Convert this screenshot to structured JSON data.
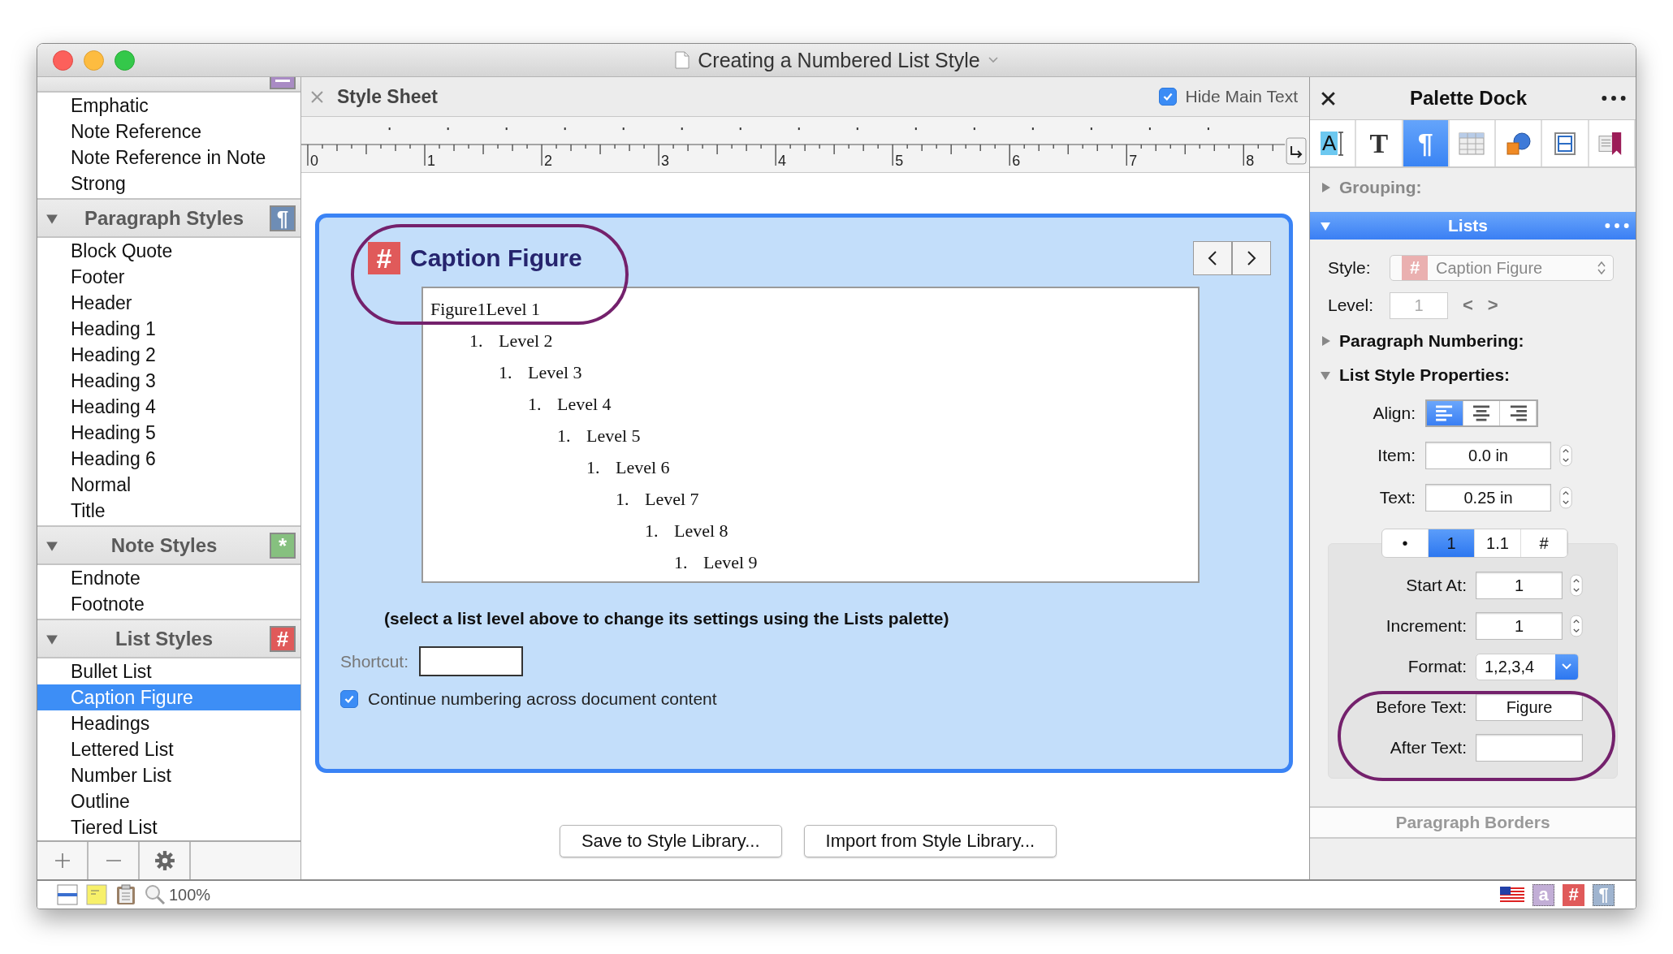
{
  "window": {
    "title": "Creating a Numbered List Style"
  },
  "sidebar": {
    "sections": [
      {
        "color": "#a98bc4",
        "items": [
          {
            "label": "Emphatic",
            "selected": false
          },
          {
            "label": "Note Reference",
            "selected": false
          },
          {
            "label": "Note Reference in Note",
            "selected": false
          },
          {
            "label": "Strong",
            "selected": false
          }
        ]
      },
      {
        "title": "Paragraph Styles",
        "expanded": true,
        "glyph": "¶",
        "color": "#6e8db5",
        "items": [
          {
            "label": "Block Quote",
            "selected": false
          },
          {
            "label": "Footer",
            "selected": false
          },
          {
            "label": "Header",
            "selected": false
          },
          {
            "label": "Heading 1",
            "selected": false
          },
          {
            "label": "Heading 2",
            "selected": false
          },
          {
            "label": "Heading 3",
            "selected": false
          },
          {
            "label": "Heading 4",
            "selected": false
          },
          {
            "label": "Heading 5",
            "selected": false
          },
          {
            "label": "Heading 6",
            "selected": false
          },
          {
            "label": "Normal",
            "selected": false
          },
          {
            "label": "Title",
            "selected": false
          }
        ]
      },
      {
        "title": "Note Styles",
        "expanded": true,
        "glyph": "*",
        "color": "#86c07f",
        "items": [
          {
            "label": "Endnote",
            "selected": false
          },
          {
            "label": "Footnote",
            "selected": false
          }
        ]
      },
      {
        "title": "List Styles",
        "expanded": true,
        "glyph": "#",
        "color": "#e05a5a",
        "items": [
          {
            "label": "Bullet List",
            "selected": false
          },
          {
            "label": "Caption Figure",
            "selected": true
          },
          {
            "label": "Headings",
            "selected": false
          },
          {
            "label": "Lettered List",
            "selected": false
          },
          {
            "label": "Number List",
            "selected": false
          },
          {
            "label": "Outline",
            "selected": false
          },
          {
            "label": "Tiered List",
            "selected": false
          }
        ]
      }
    ]
  },
  "style_sheet": {
    "title": "Style Sheet",
    "hide_main_text": {
      "label": "Hide Main Text",
      "checked": true
    },
    "ruler_labels": [
      "0",
      "1",
      "2",
      "3",
      "4",
      "5",
      "6",
      "7",
      "8"
    ],
    "style": {
      "glyph": "#",
      "name": "Caption Figure"
    },
    "preview": [
      {
        "text": "Figure1Level 1",
        "children": [
          {
            "number": "1.",
            "text": "Level 2",
            "children": [
              {
                "number": "1.",
                "text": "Level 3",
                "children": [
                  {
                    "number": "1.",
                    "text": "Level 4",
                    "children": [
                      {
                        "number": "1.",
                        "text": "Level 5",
                        "children": [
                          {
                            "number": "1.",
                            "text": "Level 6",
                            "children": [
                              {
                                "number": "1.",
                                "text": "Level 7",
                                "children": [
                                  {
                                    "number": "1.",
                                    "text": "Level 8",
                                    "children": [
                                      {
                                        "number": "1.",
                                        "text": "Level 9"
                                      }
                                    ]
                                  }
                                ]
                              }
                            ]
                          }
                        ]
                      }
                    ]
                  }
                ]
              }
            ]
          }
        ]
      }
    ],
    "hint": "(select a list level above to change its settings using the Lists palette)",
    "shortcut": {
      "label": "Shortcut:"
    },
    "continue_numbering": {
      "label": "Continue numbering across document content",
      "checked": true
    },
    "buttons": [
      "Save to Style Library...",
      "Import from Style Library..."
    ]
  },
  "palette": {
    "title": "Palette Dock",
    "tools": [
      {
        "kind": "character",
        "glyph": "A",
        "selected": false
      },
      {
        "kind": "text",
        "glyph": "T",
        "selected": false
      },
      {
        "kind": "paragraph",
        "glyph": "¶",
        "selected": true
      },
      {
        "kind": "table",
        "selected": false
      },
      {
        "kind": "shapes",
        "selected": false
      },
      {
        "kind": "layout",
        "selected": false
      },
      {
        "kind": "bookmark",
        "selected": false
      }
    ],
    "grouping": {
      "label": "Grouping:",
      "expanded": false
    },
    "lists": {
      "title": "Lists",
      "expanded": true,
      "style": {
        "label": "Style:",
        "glyph": "#",
        "value": "Caption Figure",
        "disabled": true
      },
      "level": {
        "label": "Level:",
        "value": "1",
        "disabled": true,
        "prev": "<",
        "next": ">"
      },
      "paragraph_numbering": {
        "label": "Paragraph Numbering:",
        "expanded": false
      },
      "list_style_properties": {
        "label": "List Style Properties:",
        "expanded": true
      },
      "align": {
        "label": "Align:",
        "options": [
          {
            "kind": "left",
            "selected": true
          },
          {
            "kind": "center",
            "selected": false
          },
          {
            "kind": "right",
            "selected": false
          }
        ]
      },
      "item": {
        "label": "Item:",
        "value": "0.0 in"
      },
      "text": {
        "label": "Text:",
        "value": "0.25 in"
      },
      "number_types": [
        {
          "label": "•",
          "selected": false
        },
        {
          "label": "1",
          "selected": true
        },
        {
          "label": "1.1",
          "selected": false
        },
        {
          "label": "#",
          "selected": false
        }
      ],
      "start_at": {
        "label": "Start At:",
        "value": "1"
      },
      "increment": {
        "label": "Increment:",
        "value": "1"
      },
      "format": {
        "label": "Format:",
        "value": "1,2,3,4"
      },
      "before_text": {
        "label": "Before Text:",
        "value": "Figure"
      },
      "after_text": {
        "label": "After Text:"
      }
    },
    "paragraph_borders": {
      "title": "Paragraph Borders"
    }
  },
  "status_bar": {
    "zoom": "100%",
    "indicators": [
      {
        "kind": "flag"
      },
      {
        "kind": "character",
        "glyph": "a"
      },
      {
        "kind": "list",
        "glyph": "#"
      },
      {
        "kind": "paragraph",
        "glyph": "¶"
      }
    ]
  }
}
